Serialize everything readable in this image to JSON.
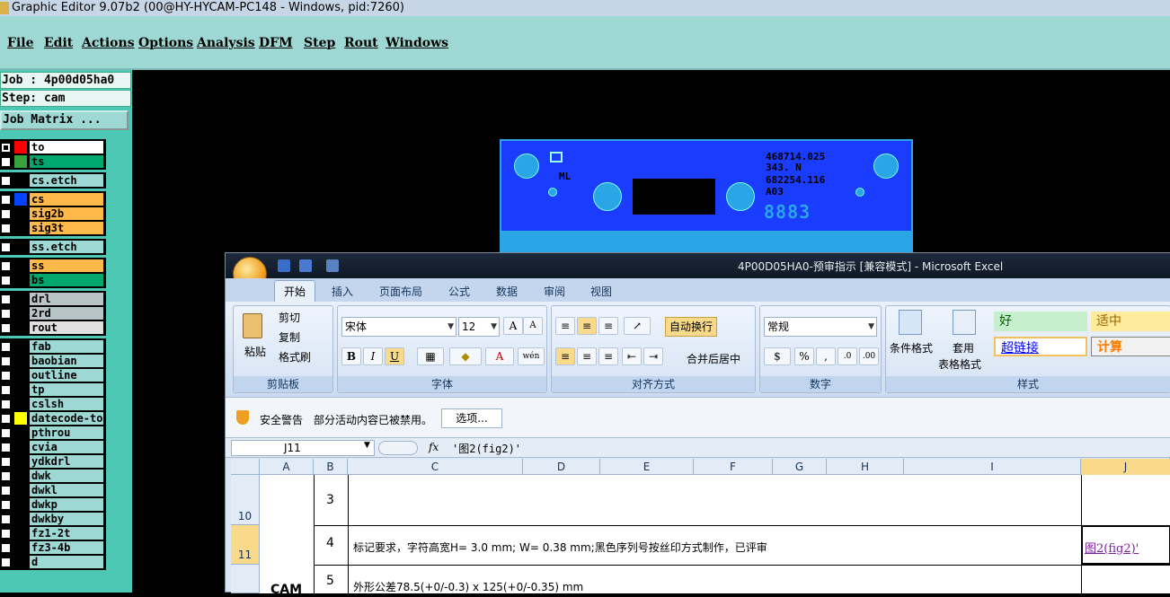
{
  "window": {
    "title": "Graphic Editor 9.07b2 (00@HY-HYCAM-PC148 - Windows, pid:7260)"
  },
  "menu": [
    "File",
    "Edit",
    "Actions",
    "Options",
    "Analysis",
    "DFM",
    "Step",
    "Rout",
    "Windows"
  ],
  "panel": {
    "job": "Job : 4p00d05ha0",
    "step": "Step: cam",
    "job_matrix": "Job Matrix ..."
  },
  "layers": [
    {
      "name": "to",
      "color": "#ffffff",
      "swatch": "#ff0000",
      "selected": true
    },
    {
      "name": "ts",
      "color": "#00a870",
      "swatch": "#3aa23a",
      "selected": false
    },
    {
      "name": "cs.etch",
      "color": "#9ed8d4",
      "swatch": "#000000",
      "selected": false
    },
    {
      "name": "cs",
      "color": "#ffb84a",
      "swatch": "#0044ff",
      "selected": false
    },
    {
      "name": "sig2b",
      "color": "#ffb84a",
      "swatch": "#000000",
      "selected": false
    },
    {
      "name": "sig3t",
      "color": "#ffb84a",
      "swatch": "#000000",
      "selected": false
    },
    {
      "name": "ss.etch",
      "color": "#9ed8d4",
      "swatch": "#000000",
      "selected": false
    },
    {
      "name": "ss",
      "color": "#ffb84a",
      "swatch": "#000000",
      "selected": false
    },
    {
      "name": "bs",
      "color": "#00a870",
      "swatch": "#000000",
      "selected": false
    },
    {
      "name": "drl",
      "color": "#b8c4c6",
      "swatch": "#000000",
      "selected": false
    },
    {
      "name": "2rd",
      "color": "#b8c4c6",
      "swatch": "#000000",
      "selected": false
    },
    {
      "name": "rout",
      "color": "#e0e0e0",
      "swatch": "#000000",
      "selected": false
    },
    {
      "name": "fab",
      "color": "#9ed8d4",
      "swatch": "#000000",
      "selected": false
    },
    {
      "name": "baobian",
      "color": "#9ed8d4",
      "swatch": "#000000",
      "selected": false
    },
    {
      "name": "outline",
      "color": "#9ed8d4",
      "swatch": "#000000",
      "selected": false
    },
    {
      "name": "tp",
      "color": "#9ed8d4",
      "swatch": "#000000",
      "selected": false
    },
    {
      "name": "cslsh",
      "color": "#9ed8d4",
      "swatch": "#000000",
      "selected": false
    },
    {
      "name": "datecode-to",
      "color": "#9ed8d4",
      "swatch": "#ffff00",
      "selected": false
    },
    {
      "name": "pthrou",
      "color": "#9ed8d4",
      "swatch": "#000000",
      "selected": false
    },
    {
      "name": "cvia",
      "color": "#9ed8d4",
      "swatch": "#000000",
      "selected": false
    },
    {
      "name": "ydkdrl",
      "color": "#9ed8d4",
      "swatch": "#000000",
      "selected": false
    },
    {
      "name": "dwk",
      "color": "#9ed8d4",
      "swatch": "#000000",
      "selected": false
    },
    {
      "name": "dwkl",
      "color": "#9ed8d4",
      "swatch": "#000000",
      "selected": false
    },
    {
      "name": "dwkp",
      "color": "#9ed8d4",
      "swatch": "#000000",
      "selected": false
    },
    {
      "name": "dwkby",
      "color": "#9ed8d4",
      "swatch": "#000000",
      "selected": false
    },
    {
      "name": "fz1-2t",
      "color": "#9ed8d4",
      "swatch": "#000000",
      "selected": false
    },
    {
      "name": "fz3-4b",
      "color": "#9ed8d4",
      "swatch": "#000000",
      "selected": false
    },
    {
      "name": "d",
      "color": "#9ed8d4",
      "swatch": "#000000",
      "selected": false
    }
  ],
  "board": {
    "text1": "468714.025",
    "text2": "343. N",
    "text3": "682254.116",
    "text4": "A03",
    "digits": "8883",
    "logo": "ML"
  },
  "excel": {
    "title": "4P00D05HA0-预审指示 [兼容模式] - Microsoft Excel",
    "tabs": [
      "开始",
      "插入",
      "页面布局",
      "公式",
      "数据",
      "审阅",
      "视图"
    ],
    "clipboard": {
      "paste": "粘贴",
      "cut": "剪切",
      "copy": "复制",
      "format_painter": "格式刷",
      "label": "剪贴板"
    },
    "font": {
      "name": "宋体",
      "size": "12",
      "label": "字体",
      "bold": "B",
      "italic": "I",
      "underline": "U"
    },
    "alignment": {
      "wrap": "自动换行",
      "merge": "合并后居中",
      "label": "对齐方式"
    },
    "number": {
      "format": "常规",
      "percent": "%",
      "comma": ",",
      "label": "数字"
    },
    "styles": {
      "conditional": "条件格式",
      "table1": "套用",
      "table2": "表格格式",
      "good": "好",
      "neutral": "适中",
      "hyperlink": "超链接",
      "calc": "计算",
      "label": "样式"
    },
    "security": {
      "warning": "安全警告",
      "message": "部分活动内容已被禁用。",
      "options": "选项..."
    },
    "namebox": "J11",
    "fx": "fx",
    "formula": "'图2(fig2)'",
    "columns": [
      "A",
      "B",
      "C",
      "D",
      "E",
      "F",
      "G",
      "H",
      "I",
      "J"
    ],
    "rows": [
      {
        "num": "10",
        "b": "3",
        "c": "",
        "j": ""
      },
      {
        "num": "11",
        "b": "4",
        "c": "标记要求，字符高宽H= 3.0 mm; W= 0.38 mm;黑色序列号按丝印方式制作，已评审",
        "j": "图2(fig2)'"
      },
      {
        "num": "",
        "b": "5",
        "c": "外形公差78.5(+0/-0.3) x 125(+0/-0.35) mm",
        "j": ""
      }
    ],
    "a_text": "CAM"
  }
}
